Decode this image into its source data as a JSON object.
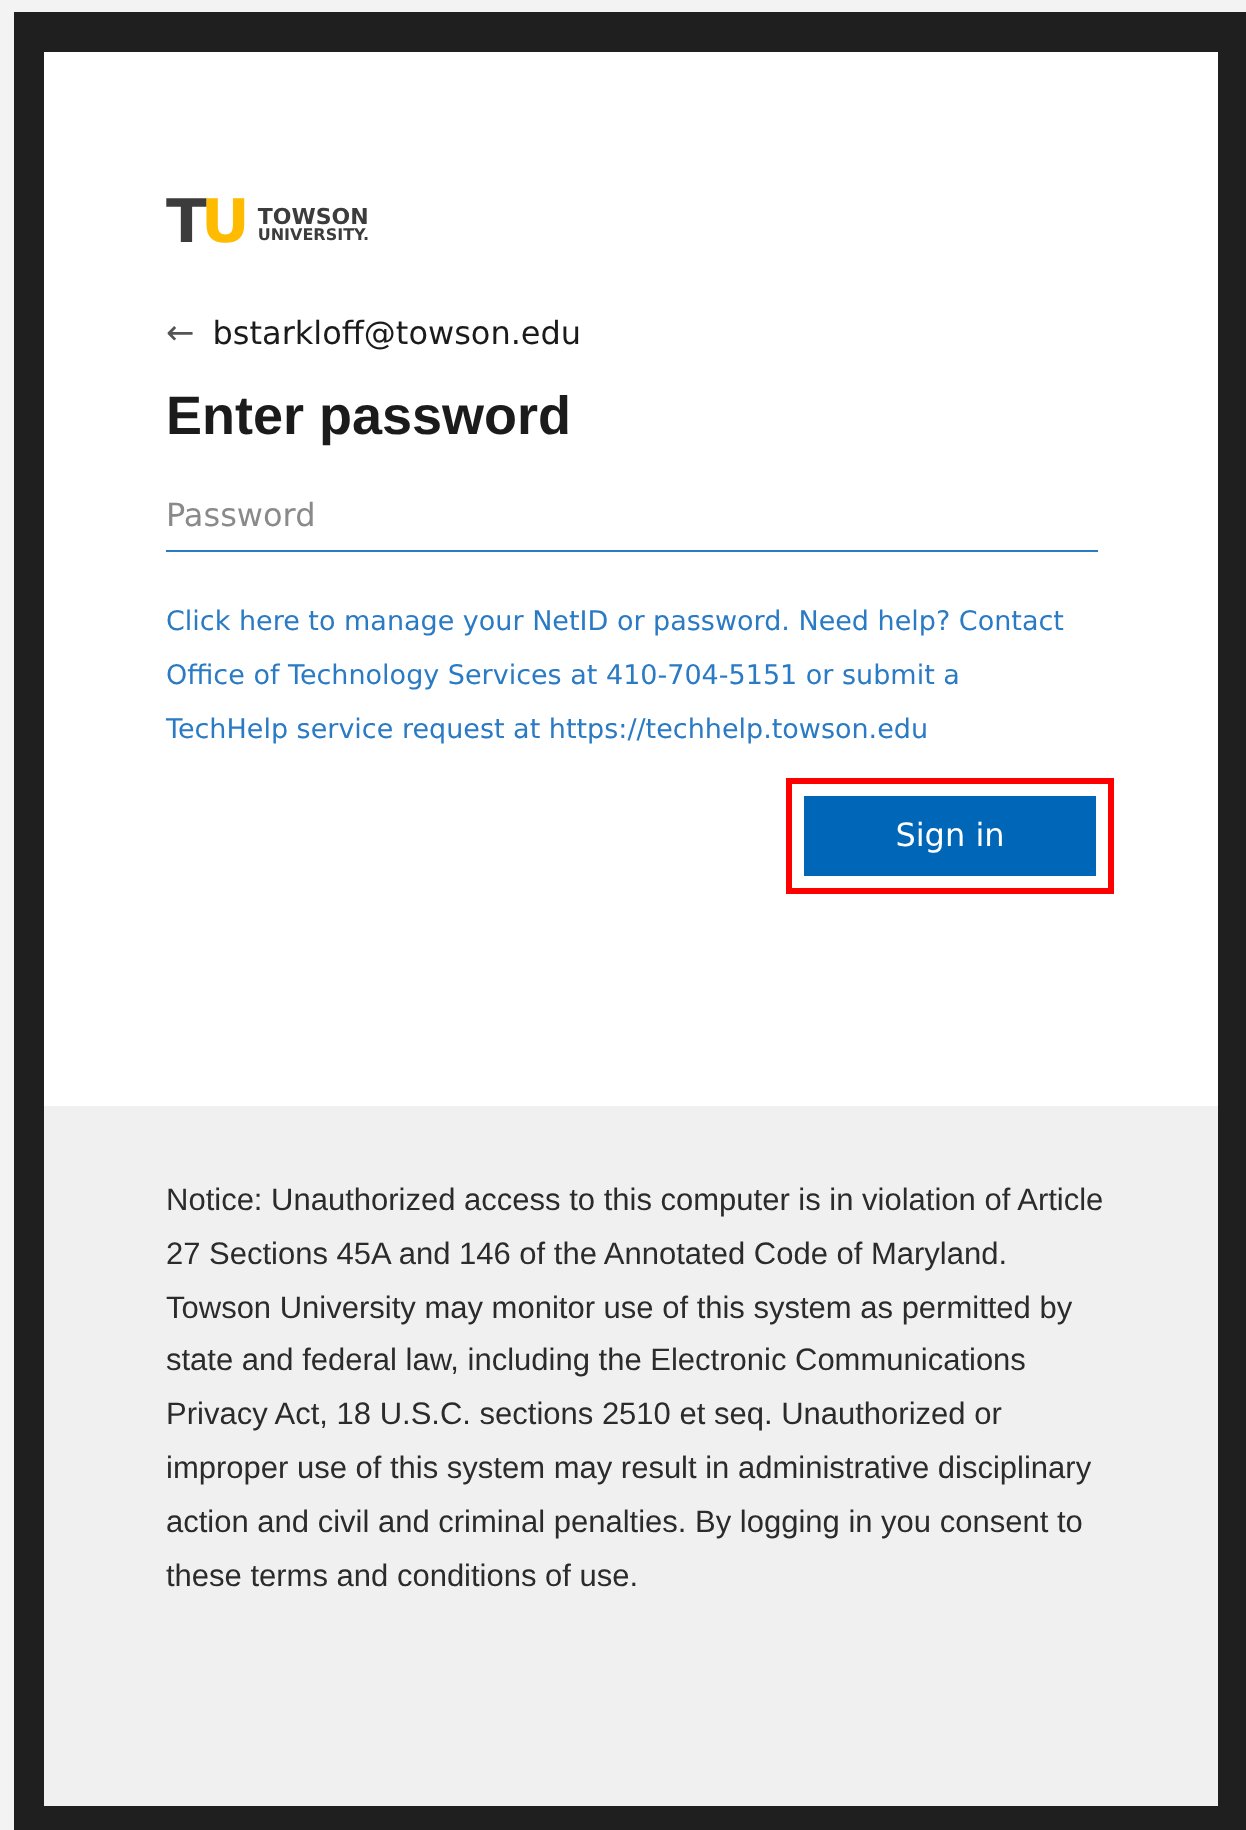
{
  "logo": {
    "mark": [
      "T",
      "U"
    ],
    "name": "TOWSON",
    "subname": "UNIVERSITY."
  },
  "identity": {
    "back_glyph": "←",
    "email": "bstarkloff@towson.edu"
  },
  "title": "Enter password",
  "password_field": {
    "placeholder": "Password",
    "focused": true
  },
  "help_text": "Click here to manage your NetID or password. Need help? Contact Office of Technology Services at 410-704-5151 or submit a TechHelp service request at https://techhelp.towson.edu",
  "sign_in_button": {
    "label": "Sign in",
    "highlighted": true
  },
  "notice": "Notice: Unauthorized access to this computer is in violation of Article 27 Sections 45A and 146 of the Annotated Code of Maryland. Towson University may monitor use of this system as permitted by state and federal law, including the Electronic Communications Privacy Act, 18 U.S.C. sections 2510 et seq. Unauthorized or improper use of this system may result in administrative disciplinary action and civil and criminal penalties. By logging in you consent to these terms and conditions of use."
}
